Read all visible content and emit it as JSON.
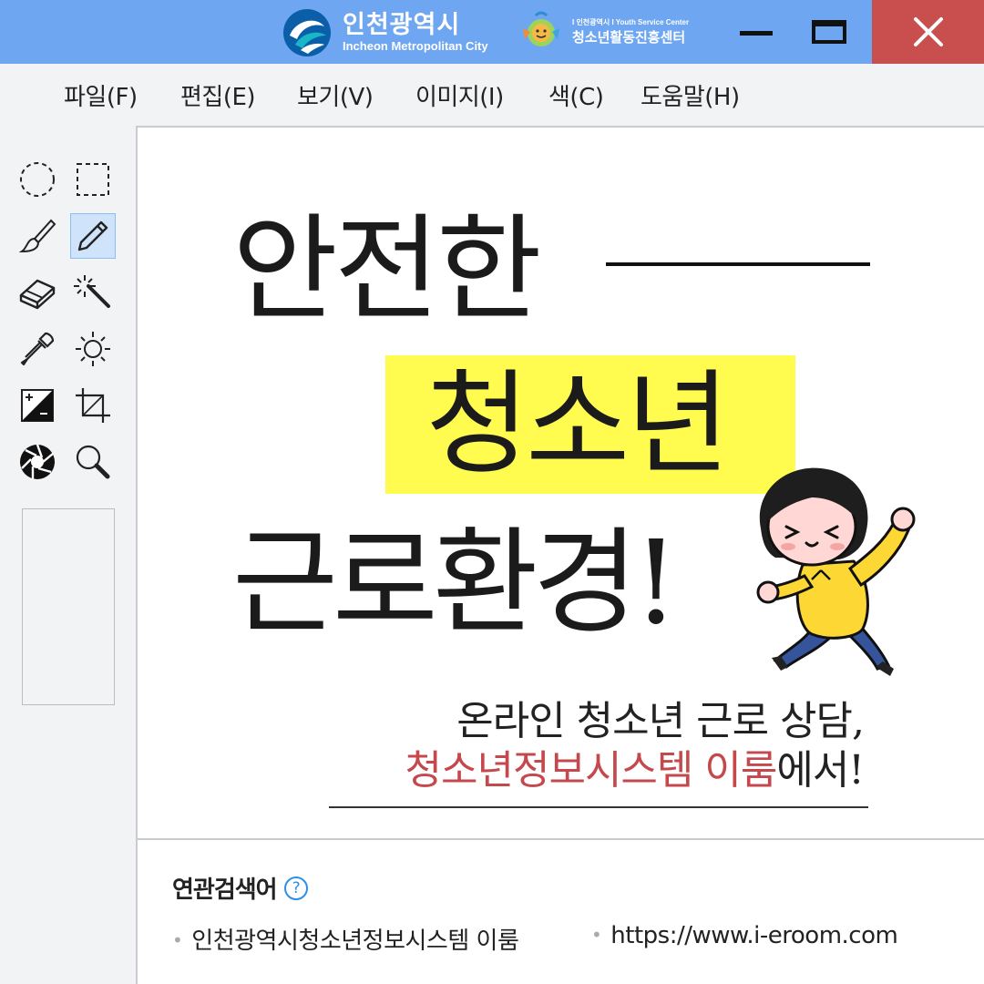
{
  "titlebar": {
    "logo1": {
      "ko": "인천광역시",
      "en": "Incheon Metropolitan City"
    },
    "logo2": {
      "small": "I 인천광역시 I Youth Service Center",
      "big": "청소년활동진흥센터"
    },
    "bg": "#6ea6f2",
    "close_bg": "#c94f4f"
  },
  "menu": [
    {
      "label": "파일(F)"
    },
    {
      "label": "편집(E)"
    },
    {
      "label": "보기(V)"
    },
    {
      "label": "이미지(I)"
    },
    {
      "label": "색(C)"
    },
    {
      "label": "도움말(H)"
    }
  ],
  "tools": [
    "ellipse-select-icon",
    "rect-select-icon",
    "brush-icon",
    "pencil-icon",
    "eraser-icon",
    "magic-wand-icon",
    "eyedropper-icon",
    "brightness-icon",
    "contrast-icon",
    "crop-icon",
    "aperture-icon",
    "magnifier-icon"
  ],
  "canvas": {
    "line1": "안전한",
    "line2": "청소년",
    "line3": "근로환경!",
    "sub1": "온라인 청소년 근로 상담,",
    "sub2_red": "청소년정보시스템 이룸",
    "sub2_rest": "에서!",
    "highlight_color": "#fffc4f",
    "accent_red": "#c4484c"
  },
  "related": {
    "title": "연관검색어",
    "help": "?",
    "keywords": [
      "인천광역시청소년정보시스템 이룸",
      "https://www.i-eroom.com"
    ]
  }
}
